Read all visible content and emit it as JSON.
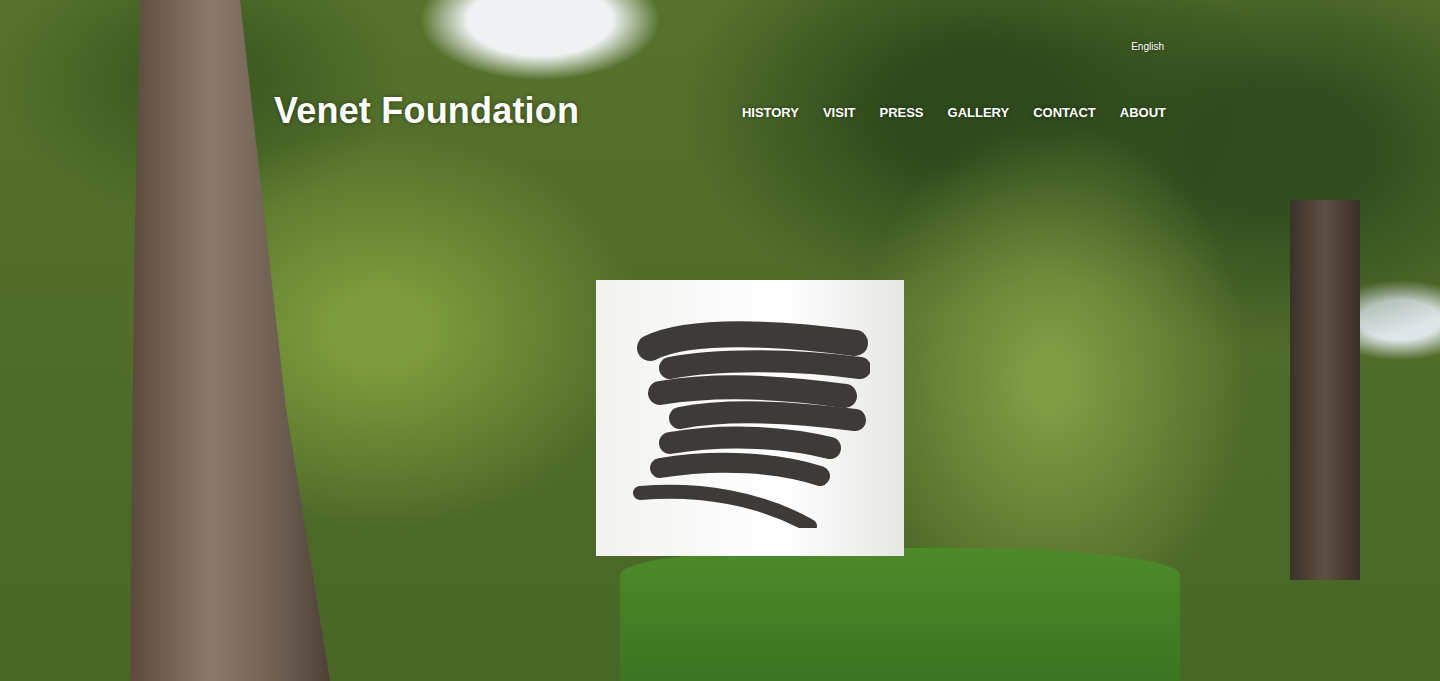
{
  "header": {
    "logo": "Venet Foundation",
    "language": "English"
  },
  "nav": [
    {
      "label": "HISTORY"
    },
    {
      "label": "VISIT"
    },
    {
      "label": "PRESS"
    },
    {
      "label": "GALLERY"
    },
    {
      "label": "CONTACT"
    },
    {
      "label": "ABOUT"
    }
  ]
}
